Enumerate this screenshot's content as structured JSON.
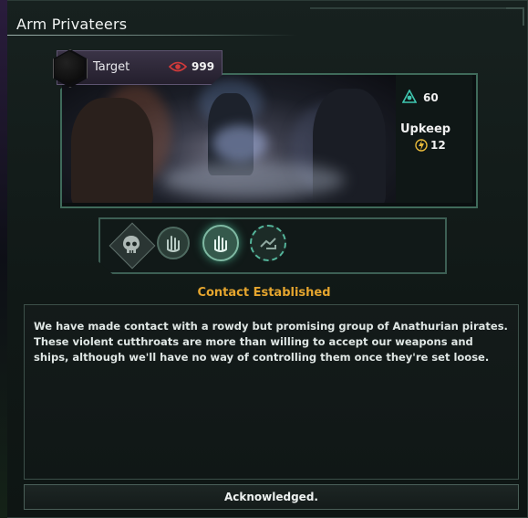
{
  "window": {
    "title": "Arm Privateers"
  },
  "target": {
    "label": "Target",
    "value": "999",
    "icon": "eye-icon"
  },
  "stats": {
    "influence_value": "60",
    "influence_icon": "influence-icon",
    "upkeep_label": "Upkeep",
    "energy_value": "12",
    "energy_icon": "energy-icon"
  },
  "progress": {
    "stages": [
      {
        "icon": "skull-icon",
        "state": "start"
      },
      {
        "icon": "hand-signal-icon",
        "state": "complete"
      },
      {
        "icon": "hand-signal-icon",
        "state": "current"
      },
      {
        "icon": "handshake-icon",
        "state": "next"
      }
    ]
  },
  "event": {
    "heading": "Contact Established",
    "description": "We have made contact with a rowdy but promising group of Anathurian pirates. These violent cutthroats are more than willing to accept our weapons and ships, although we'll have no way of controlling them once they're set loose."
  },
  "actions": {
    "acknowledge_label": "Acknowledged."
  },
  "colors": {
    "accent_gold": "#e5a52e",
    "frame_teal": "#3f6a5a",
    "eye_red": "#d23a3a"
  }
}
